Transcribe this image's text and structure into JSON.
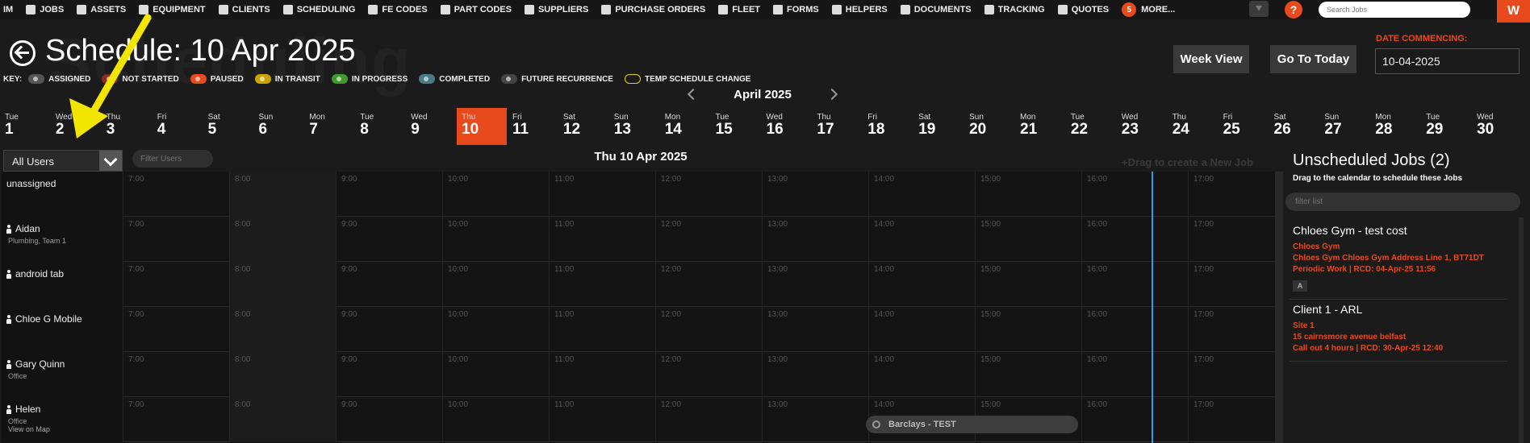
{
  "nav": {
    "items": [
      "IM",
      "JOBS",
      "ASSETS",
      "EQUIPMENT",
      "CLIENTS",
      "SCHEDULING",
      "FE CODES",
      "PART CODES",
      "SUPPLIERS",
      "PURCHASE ORDERS",
      "FLEET",
      "FORMS",
      "HELPERS",
      "DOCUMENTS",
      "TRACKING",
      "QUOTES"
    ],
    "more_count": "5",
    "more_label": "MORE...",
    "help": "?",
    "search_placeholder": "Search Jobs",
    "brand": "W"
  },
  "header": {
    "watermark": "Scheduling",
    "title": "Schedule: 10 Apr 2025",
    "week_view": "Week View",
    "go_today": "Go To Today",
    "date_label": "DATE COMMENCING:",
    "date_value": "10-04-2025"
  },
  "key": {
    "label": "KEY:",
    "items": [
      {
        "label": "ASSIGNED",
        "color": "#555555"
      },
      {
        "label": "NOT STARTED",
        "color": "#8a2c1c"
      },
      {
        "label": "PAUSED",
        "color": "#e8491d"
      },
      {
        "label": "IN TRANSIT",
        "color": "#c9a300"
      },
      {
        "label": "IN PROGRESS",
        "color": "#3f9a2c"
      },
      {
        "label": "COMPLETED",
        "color": "#4a7a86"
      },
      {
        "label": "FUTURE RECURRENCE",
        "color": "#444444"
      },
      {
        "label": "TEMP SCHEDULE CHANGE",
        "color": "outline"
      }
    ]
  },
  "month": "April 2025",
  "days": [
    {
      "n": "Tue",
      "d": "1"
    },
    {
      "n": "Wed",
      "d": "2"
    },
    {
      "n": "Thu",
      "d": "3"
    },
    {
      "n": "Fri",
      "d": "4"
    },
    {
      "n": "Sat",
      "d": "5"
    },
    {
      "n": "Sun",
      "d": "6"
    },
    {
      "n": "Mon",
      "d": "7"
    },
    {
      "n": "Tue",
      "d": "8"
    },
    {
      "n": "Wed",
      "d": "9"
    },
    {
      "n": "Thu",
      "d": "10"
    },
    {
      "n": "Fri",
      "d": "11"
    },
    {
      "n": "Sat",
      "d": "12"
    },
    {
      "n": "Sun",
      "d": "13"
    },
    {
      "n": "Mon",
      "d": "14"
    },
    {
      "n": "Tue",
      "d": "15"
    },
    {
      "n": "Wed",
      "d": "16"
    },
    {
      "n": "Thu",
      "d": "17"
    },
    {
      "n": "Fri",
      "d": "18"
    },
    {
      "n": "Sat",
      "d": "19"
    },
    {
      "n": "Sun",
      "d": "20"
    },
    {
      "n": "Mon",
      "d": "21"
    },
    {
      "n": "Tue",
      "d": "22"
    },
    {
      "n": "Wed",
      "d": "23"
    },
    {
      "n": "Thu",
      "d": "24"
    },
    {
      "n": "Fri",
      "d": "25"
    },
    {
      "n": "Sat",
      "d": "26"
    },
    {
      "n": "Sun",
      "d": "27"
    },
    {
      "n": "Mon",
      "d": "28"
    },
    {
      "n": "Tue",
      "d": "29"
    },
    {
      "n": "Wed",
      "d": "30"
    }
  ],
  "selected_day": "10",
  "filters": {
    "user_select": "All Users",
    "filter_users_placeholder": "Filter Users",
    "date_heading": "Thu 10 Apr 2025",
    "drag_hint": "+Drag to create a New Job"
  },
  "times": [
    "7:00",
    "8:00",
    "9:00",
    "10:00",
    "11:00",
    "12:00",
    "13:00",
    "14:00",
    "15:00",
    "16:00",
    "17:00"
  ],
  "rows": [
    {
      "name": "unassigned",
      "sub": "",
      "link": "",
      "person": false
    },
    {
      "name": "Aidan",
      "sub": "Plumbing, Team 1",
      "link": "",
      "person": true
    },
    {
      "name": "android tab",
      "sub": "",
      "link": "",
      "person": true
    },
    {
      "name": "Chloe G Mobile",
      "sub": "",
      "link": "",
      "person": true
    },
    {
      "name": "Gary Quinn",
      "sub": "Office",
      "link": "",
      "person": true
    },
    {
      "name": "Helen",
      "sub": "Office",
      "link": "View on Map",
      "person": true
    }
  ],
  "scheduled_job": {
    "label": "Barclays - TEST"
  },
  "unscheduled": {
    "title": "Unscheduled Jobs (2)",
    "subtitle": "Drag to the calendar to schedule these Jobs",
    "filter_placeholder": "filter list",
    "jobs": [
      {
        "title": "Chloes Gym - test cost",
        "lines": [
          "Chloes Gym",
          "Chloes Gym Chloes Gym Address Line 1, BT71DT",
          "Periodic Work | RCD: 04-Apr-25 11:56"
        ],
        "tag": "A"
      },
      {
        "title": "Client 1 - ARL",
        "lines": [
          "Site 1",
          "15 cairnsmore avenue belfast",
          "Call out 4 hours | RCD: 30-Apr-25 12:40"
        ],
        "tag": ""
      }
    ]
  }
}
